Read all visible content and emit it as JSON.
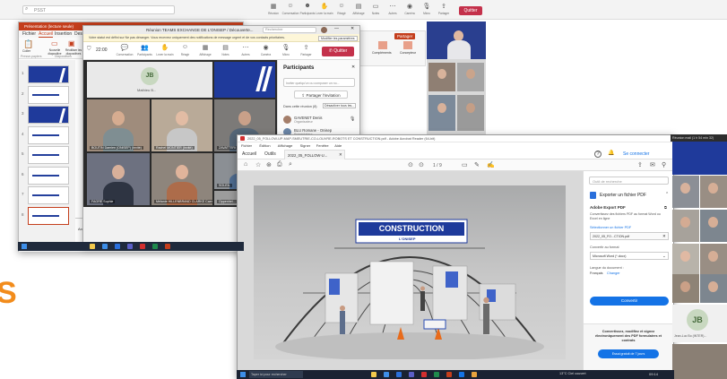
{
  "search": {
    "placeholder": "PSST"
  },
  "top_toolbar": {
    "items": [
      "Réunion",
      "Conversation",
      "Participants",
      "Lever la main",
      "Réagir",
      "Affichage",
      "Notes",
      "Autres",
      "Caméra",
      "Micro",
      "Partager"
    ],
    "leave_label": "Quitter"
  },
  "ppt": {
    "title_tab": "Présentation (lecture seule)",
    "ribbon_tabs": [
      "Fichier",
      "Accueil",
      "Insertion",
      "Dess"
    ],
    "left_labels": [
      "Coller",
      "Presse-papiers"
    ],
    "ribbon_labels": [
      "Nouvelle diapositive",
      "Réutiliser les diapositives",
      "Diapositives"
    ],
    "status_text": "Diapositive 1 sur 11",
    "status_extra": "Accessibilité : consultez nos recommandations",
    "slide_numbers": [
      "1",
      "2",
      "3",
      "4",
      "5",
      "6",
      "7",
      "8"
    ],
    "notes_text": "Animations immersives et grands ateliers pour découvrir les métiers qui recrutent et sur secteurs !",
    "slide_thumb_title": "ÉVÉNEMENT DE L'ONISEP",
    "right_tab": "Partager",
    "right_labels": [
      "Compléments",
      "Concepteur"
    ]
  },
  "teams": {
    "window_title": "Réunion TEAMS EXCHANGE DE L'ONISEP / Découverte...",
    "search_placeholder": "Rechercher",
    "notification": "Votre statut est défini sur Ne pas déranger. Vous recevrez uniquement des notifications de message urgent et de vos contacts prioritaires.",
    "notification_action": "Modifier les paramètres",
    "timer": "22:00",
    "toolbar": [
      "Conversation",
      "Participants",
      "Lever la main",
      "Réagir",
      "Affichage",
      "Notes",
      "Autres",
      "Caméra",
      "Micro",
      "Partager"
    ],
    "leave_label": "Quitter",
    "avatar_initials": "JB",
    "avatar_name": "Mathieu B...",
    "participants_title": "Participants",
    "participants_search": "Inviter quelqu'un ou composer un no...",
    "share_invite": "Partager l'invitation",
    "section_label": "Dans cette réunion (8)",
    "mute_all": "Désactiver tous les...",
    "participant_1_name": "GAVENET Denis",
    "participant_1_role": "Organisateur",
    "participant_2_name": "BLU Romane - Onisep",
    "participant_2_role": "Présentateur",
    "tiles": [
      "BOUTIN Damien (ONISEP) (Invité)",
      "Rachel MONTIER (Invité)",
      "ZAVATTERI SAMUEL",
      "SOLEIL",
      "FAGRE Sophie",
      "Mélanie HILLENBRAND CLARKE Caen (GUEST)",
      "Oppenhei..."
    ]
  },
  "pdf": {
    "title": "2022_05_FOLLOW-UP-MAP-SMEUTRIE-CO-LOUVRE-ROBOTS ET CONSTRUCTION.pdf - Adobe Acrobat Reader (64-bit)",
    "menu": [
      "Fichier",
      "Édition",
      "Affichage",
      "Signer",
      "Fenêtre",
      "Aide"
    ],
    "tabs": [
      "Accueil",
      "Outils"
    ],
    "doc_tab": "2022_05_FOLLOW-U...",
    "help_label": "?",
    "connect_label": "Se connecter",
    "page_indicator": "1 / 9",
    "side_search": "Outil de recherche",
    "export_title": "Exporter un fichier PDF",
    "adobe_export": "Adobe Export PDF",
    "export_desc": "Convertissez des fichiers PDF au format Word ou Excel en ligne",
    "select_file_label": "Sélectionner un fichier PDF",
    "file_name": "2022_05_FO...CTION.pdf",
    "convert_to_label": "Convertir au format",
    "format_value": "Microsoft Word (*.docx)",
    "doc_lang_label": "Langue du document :",
    "doc_lang_value": "Français",
    "change_label": "Changer",
    "convert_button": "Convertir",
    "promo_text": "Convertissez, modifiez et signez électroniquement des PDF formulaires et contrats",
    "promo_button": "Essai gratuit de 7 jours",
    "construction_banner": "CONSTRUCTION",
    "brand": "L'ONISEP"
  },
  "gallery": {
    "title": "Réunion mail (1 h 54 min 32)",
    "avatar_initials": "JB",
    "avatar_name": "Jean-Luc Bo (INTER)..."
  },
  "taskbar": {
    "search": "Taper ici pour rechercher",
    "weather": "13°C  Ciel couvert",
    "time": "09:14"
  },
  "stray_letter": "S"
}
